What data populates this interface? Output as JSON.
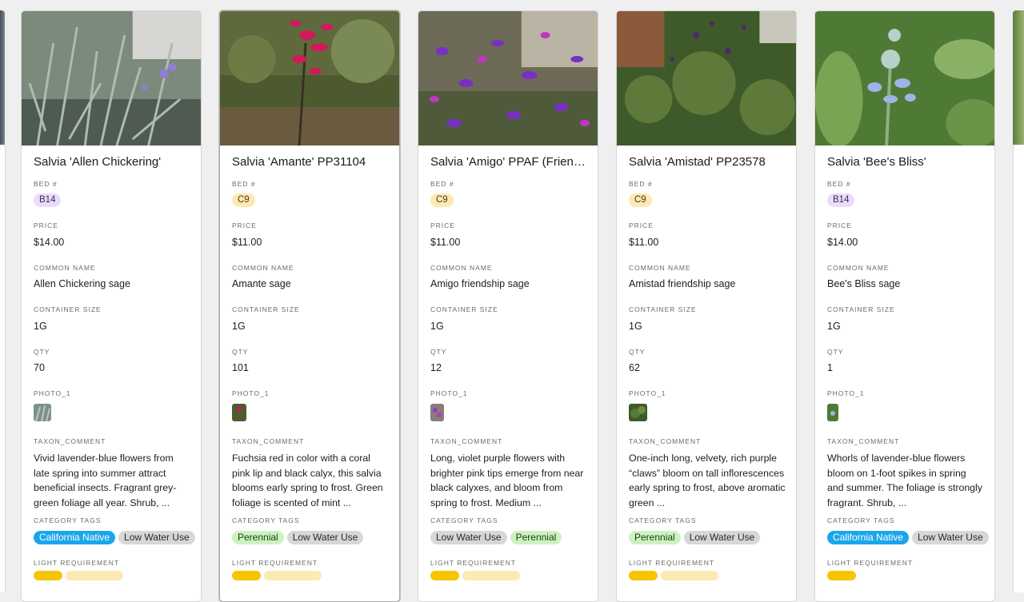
{
  "labels": {
    "bed": "BED #",
    "price": "PRICE",
    "common_name": "COMMON NAME",
    "container_size": "CONTAINER SIZE",
    "qty": "QTY",
    "photo": "PHOTO_1",
    "taxon_comment": "TAXON_COMMENT",
    "category_tags": "CATEGORY TAGS",
    "light_requirement": "LIGHT REQUIREMENT"
  },
  "cards": [
    {
      "title": "Salvia 'Allen Chickering'",
      "bed": "B14",
      "price": "$14.00",
      "common_name": "Allen Chickering sage",
      "container_size": "1G",
      "qty": "70",
      "comment": "Vivid lavender-blue flowers from late spring into summer attract beneficial insects. Fragrant grey-green foliage all year. Shrub, ...",
      "tags": [
        "California Native",
        "Low Water Use"
      ]
    },
    {
      "title": "Salvia 'Amante' PP31104",
      "bed": "C9",
      "price": "$11.00",
      "common_name": "Amante sage",
      "container_size": "1G",
      "qty": "101",
      "comment": "Fuchsia red in color with a coral pink lip and black calyx, this salvia blooms early spring to frost. Green foliage is scented of mint ...",
      "tags": [
        "Perennial",
        "Low Water Use"
      ]
    },
    {
      "title": "Salvia 'Amigo' PPAF (Friendship Sage)",
      "bed": "C9",
      "price": "$11.00",
      "common_name": "Amigo friendship sage",
      "container_size": "1G",
      "qty": "12",
      "comment": "Long, violet purple flowers with brighter pink tips emerge from near black calyxes, and bloom from spring to frost. Medium ...",
      "tags": [
        "Low Water Use",
        "Perennial"
      ]
    },
    {
      "title": "Salvia 'Amistad' PP23578",
      "bed": "C9",
      "price": "$11.00",
      "common_name": "Amistad friendship sage",
      "container_size": "1G",
      "qty": "62",
      "comment": "One-inch long, velvety, rich purple “claws” bloom on tall inflorescences  early spring to frost, above aromatic green ...",
      "tags": [
        "Perennial",
        "Low Water Use"
      ]
    },
    {
      "title": "Salvia 'Bee's Bliss'",
      "bed": "B14",
      "price": "$14.00",
      "common_name": "Bee's Bliss sage",
      "container_size": "1G",
      "qty": "1",
      "comment": "Whorls of lavender-blue flowers bloom on 1-foot spikes in spring and summer. The foliage is strongly fragrant. Shrub, ...",
      "tags": [
        "California Native",
        "Low Water Use"
      ]
    }
  ]
}
